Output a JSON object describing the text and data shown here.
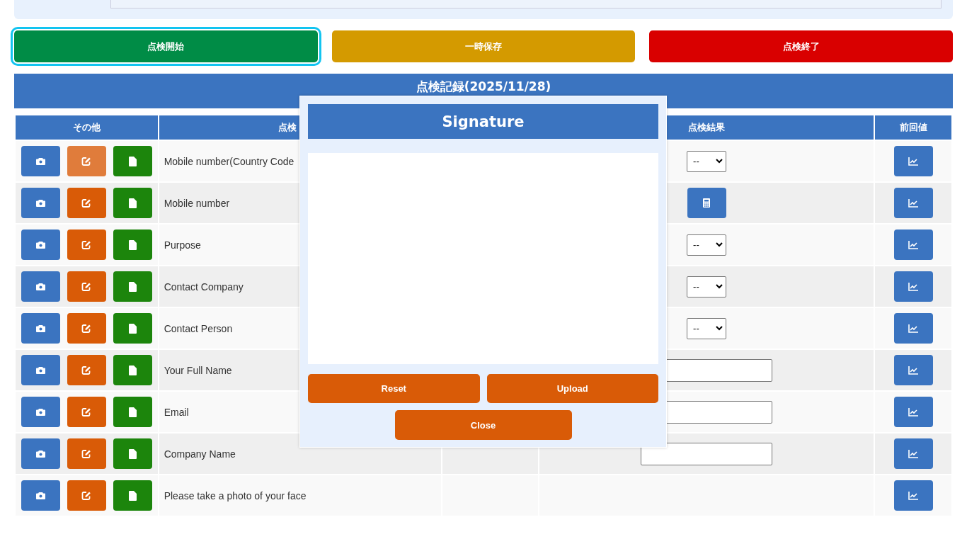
{
  "actions": [
    {
      "label": "点検開始",
      "kind": "start",
      "focused": true
    },
    {
      "label": "一時保存",
      "kind": "save",
      "focused": false
    },
    {
      "label": "点検終了",
      "kind": "end",
      "focused": false
    }
  ],
  "record_title": "点検記録(2025/11/28)",
  "table": {
    "columns": [
      "その他",
      "点検",
      "点検結果",
      "前回値"
    ],
    "rows": [
      {
        "item": "Mobile number(Country Code",
        "result": {
          "kind": "select",
          "value": "--"
        },
        "edit_highlighted": true
      },
      {
        "item": "Mobile number",
        "result": {
          "kind": "calculator"
        },
        "edit_highlighted": false
      },
      {
        "item": "Purpose",
        "result": {
          "kind": "select",
          "value": "--"
        },
        "edit_highlighted": false
      },
      {
        "item": "Contact Company",
        "result": {
          "kind": "select",
          "value": "--"
        },
        "edit_highlighted": false
      },
      {
        "item": "Contact Person",
        "result": {
          "kind": "select",
          "value": "--"
        },
        "edit_highlighted": false
      },
      {
        "item": "Your Full Name",
        "result": {
          "kind": "text"
        },
        "edit_highlighted": false
      },
      {
        "item": "Email",
        "result": {
          "kind": "text"
        },
        "edit_highlighted": false
      },
      {
        "item": "Company Name",
        "result": {
          "kind": "text"
        },
        "edit_highlighted": false
      },
      {
        "item": "Please take a photo of your face",
        "result": {
          "kind": "none"
        },
        "edit_highlighted": false
      }
    ]
  },
  "modal": {
    "title": "Signature",
    "buttons": [
      "Reset",
      "Upload"
    ],
    "close": "Close"
  }
}
